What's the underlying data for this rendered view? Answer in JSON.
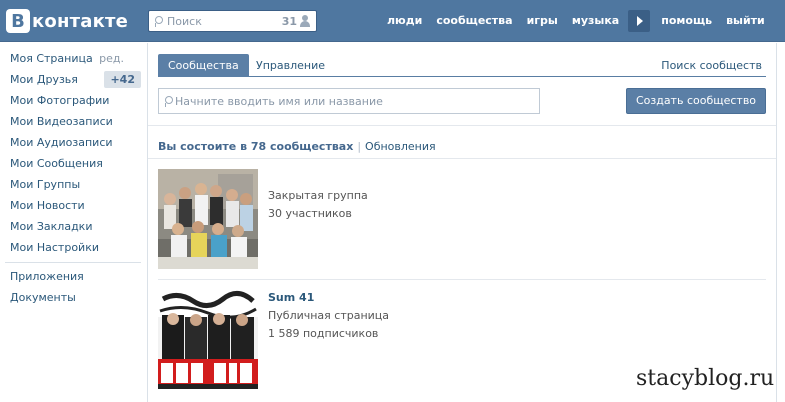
{
  "header": {
    "logo_letter": "В",
    "logo_text": "контакте",
    "search_placeholder": "Поиск",
    "search_count": "31",
    "nav": [
      "люди",
      "сообщества",
      "игры",
      "музыка",
      "помощь",
      "выйти"
    ]
  },
  "sidebar": {
    "items": [
      {
        "label": "Моя Страница",
        "extra": "ред."
      },
      {
        "label": "Мои Друзья",
        "badge": "+42"
      },
      {
        "label": "Мои Фотографии"
      },
      {
        "label": "Мои Видеозаписи"
      },
      {
        "label": "Мои Аудиозаписи"
      },
      {
        "label": "Мои Сообщения"
      },
      {
        "label": "Мои Группы"
      },
      {
        "label": "Мои Новости"
      },
      {
        "label": "Мои Закладки"
      },
      {
        "label": "Мои Настройки"
      }
    ],
    "extra_items": [
      {
        "label": "Приложения"
      },
      {
        "label": "Документы"
      }
    ]
  },
  "main": {
    "tabs": [
      {
        "label": "Сообщества"
      },
      {
        "label": "Управление"
      }
    ],
    "search_communities_link": "Поиск сообществ",
    "search_placeholder": "Начните вводить имя или название",
    "create_button": "Создать сообщество",
    "summary_main": "Вы состоите в 78 сообществах",
    "summary_separator": "|",
    "summary_link": "Обновления",
    "groups": [
      {
        "name": "",
        "type": "Закрытая группа",
        "members": "30 участников"
      },
      {
        "name": "Sum 41",
        "type": "Публичная страница",
        "members": "1 589 подписчиков"
      }
    ]
  },
  "watermark": "stacyblog.ru",
  "colors": {
    "header_bg": "#4f77a0",
    "link": "#2b587a",
    "tab_active": "#5b7fa6",
    "badge_bg": "#dae1e8"
  }
}
